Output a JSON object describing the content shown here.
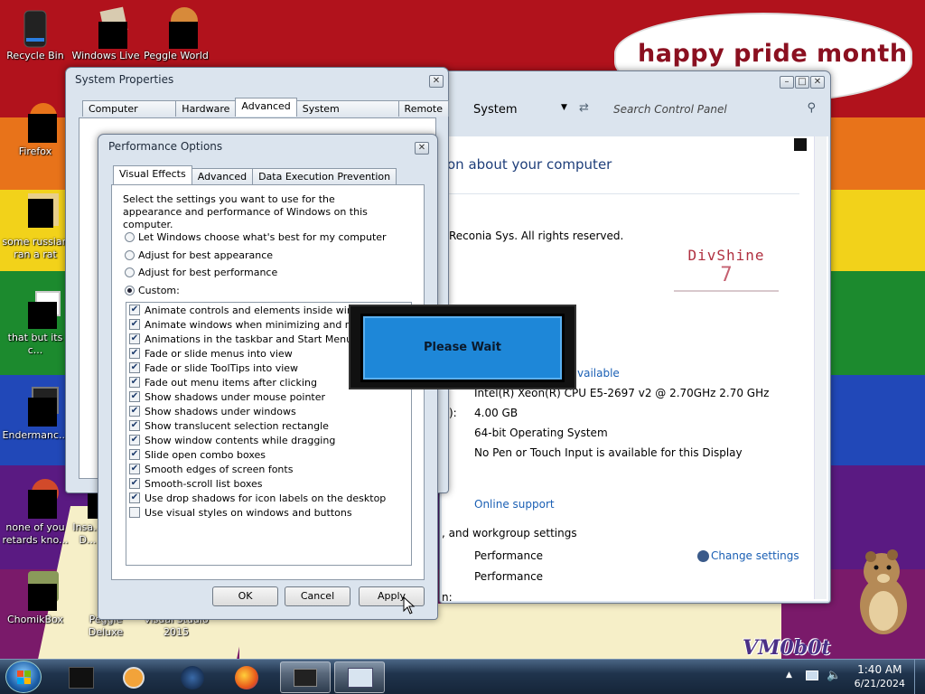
{
  "desktop": {
    "banner_text": "happy pride month",
    "watermark": "VM0b0t",
    "icons": [
      {
        "label": "Recycle Bin"
      },
      {
        "label": "Windows Live"
      },
      {
        "label": "Peggle World"
      },
      {
        "label": "Firefox"
      },
      {
        "label": "some russian ran a rat"
      },
      {
        "label": "that but its c..."
      },
      {
        "label": "Endermanc..."
      },
      {
        "label": "none of you retards kno..."
      },
      {
        "label": "Insa... D..."
      },
      {
        "label": "ChomikBox"
      },
      {
        "label": "Peggle Deluxe"
      },
      {
        "label": "Visual Studio 2015"
      }
    ]
  },
  "control_panel": {
    "breadcrumb": "System",
    "search_placeholder": "Search Control Panel",
    "heading": "on about your computer",
    "copyright": "Reconia Sys.  All rights reserved.",
    "brand_name": "DivShine",
    "brand_version": "7",
    "rating_link": "vailable",
    "processor": "Intel(R) Xeon(R) CPU E5-2697 v2 @ 2.70GHz   2.70 GHz",
    "memory_label": "):",
    "memory": "4.00 GB",
    "system_type": "64-bit Operating System",
    "pen_touch": "No Pen or Touch Input is available for this Display",
    "online_support": "Online support",
    "workgroup_heading": ", and workgroup settings",
    "computer_name_row": "Performance",
    "full_name_row": "Performance",
    "change_settings": "Change settings",
    "partial_label": "n:"
  },
  "system_properties": {
    "title": "System Properties",
    "tabs": [
      "Computer Name",
      "Hardware",
      "Advanced",
      "System Protection",
      "Remote"
    ]
  },
  "performance_options": {
    "title": "Performance Options",
    "tabs": [
      "Visual Effects",
      "Advanced",
      "Data Execution Prevention"
    ],
    "description": "Select the settings you want to use for the appearance and performance of Windows on this computer.",
    "radios": [
      {
        "label": "Let Windows choose what's best for my computer",
        "checked": false
      },
      {
        "label": "Adjust for best appearance",
        "checked": false
      },
      {
        "label": "Adjust for best performance",
        "checked": false
      },
      {
        "label": "Custom:",
        "checked": true
      }
    ],
    "effects": [
      {
        "label": "Animate controls and elements inside windows",
        "checked": true
      },
      {
        "label": "Animate windows when minimizing and maximizing",
        "checked": true
      },
      {
        "label": "Animations in the taskbar and Start Menu",
        "checked": true
      },
      {
        "label": "Fade or slide menus into view",
        "checked": true
      },
      {
        "label": "Fade or slide ToolTips into view",
        "checked": true
      },
      {
        "label": "Fade out menu items after clicking",
        "checked": true
      },
      {
        "label": "Show shadows under mouse pointer",
        "checked": true
      },
      {
        "label": "Show shadows under windows",
        "checked": true
      },
      {
        "label": "Show translucent selection rectangle",
        "checked": true
      },
      {
        "label": "Show window contents while dragging",
        "checked": true
      },
      {
        "label": "Slide open combo boxes",
        "checked": true
      },
      {
        "label": "Smooth edges of screen fonts",
        "checked": true
      },
      {
        "label": "Smooth-scroll list boxes",
        "checked": true
      },
      {
        "label": "Use drop shadows for icon labels on the desktop",
        "checked": true
      },
      {
        "label": "Use visual styles on windows and buttons",
        "checked": false
      }
    ],
    "ok_label": "OK",
    "cancel_label": "Cancel",
    "apply_label": "Apply"
  },
  "please_wait": {
    "text": "Please Wait"
  },
  "taskbar": {
    "time": "1:40 AM",
    "date": "6/21/2024"
  },
  "colors": {
    "accent_link": "#1a5fb4",
    "please_wait_blue": "#1e87d8"
  }
}
